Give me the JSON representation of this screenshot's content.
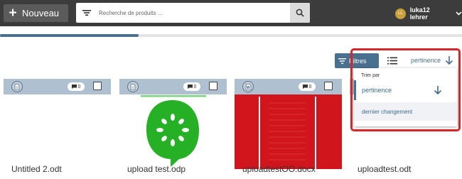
{
  "header": {
    "new_button_label": "Nouveau",
    "search_placeholder": "Recherche de produits ...",
    "user": {
      "initials": "LL",
      "name": "luka12 lehrer"
    }
  },
  "progress": {
    "percent": 30
  },
  "toolbar": {
    "filters_label": "Filtres",
    "sort_value": "pertinence"
  },
  "sort_menu": {
    "title": "Trier par",
    "options": [
      {
        "label": "pertinence",
        "selected": true
      },
      {
        "label": "dernier changement",
        "selected": false
      }
    ]
  },
  "files": [
    {
      "name": "Untitled 2.odt",
      "comments": "0",
      "badge": "doc-icon"
    },
    {
      "name": "upload test.odp",
      "comments": "0",
      "badge": "doc-icon"
    },
    {
      "name": "uploadtestOO.docx",
      "comments": "0",
      "badge": "word-doc-icon"
    },
    {
      "name": "uploadtest.odt",
      "comments": "0",
      "badge": "doc-icon"
    }
  ],
  "colors": {
    "topbar": "#3c3c3c",
    "accent": "#49708f",
    "card_header": "#afc0d1",
    "highlight": "#d6262c",
    "cucumber_green": "#25b025",
    "docx_red": "#d0161c"
  }
}
